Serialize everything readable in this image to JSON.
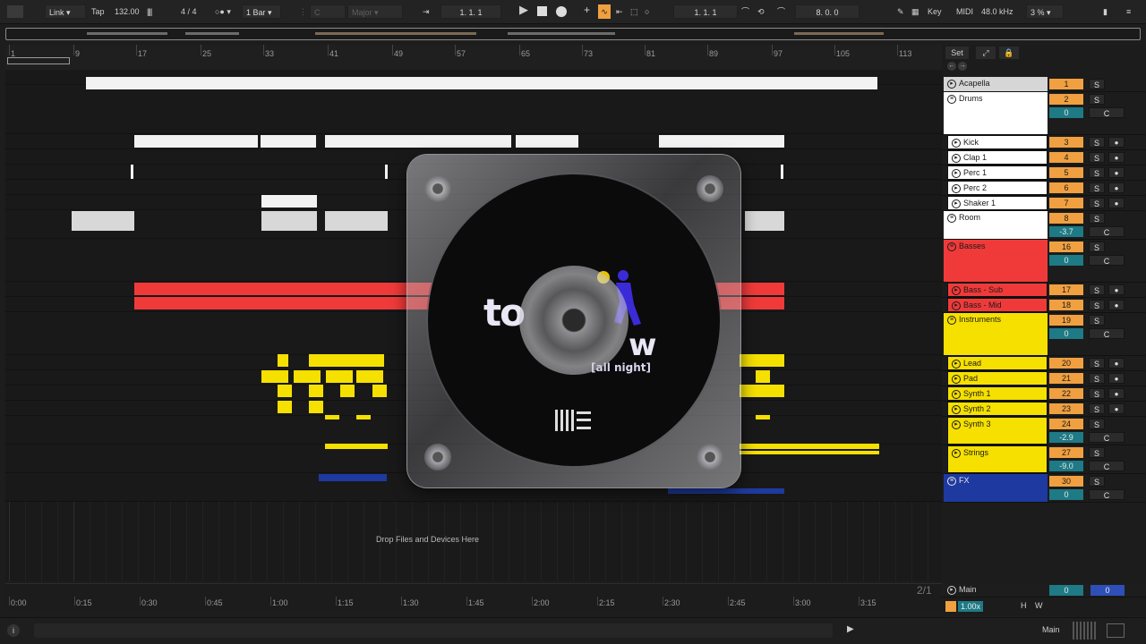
{
  "topbar": {
    "link": "Link",
    "tap": "Tap",
    "tempo": "132.00",
    "time_sig": "4 / 4",
    "quantize": "1 Bar",
    "key": "C",
    "scale": "Major",
    "position": "1.   1.   1",
    "loop_start": "1.   1.   1",
    "loop_length": "8.   0.   0",
    "key_label": "Key",
    "midi_label": "MIDI",
    "sample_rate": "48.0 kHz",
    "cpu": "3 %"
  },
  "ruler": {
    "bars": [
      "1",
      "9",
      "17",
      "25",
      "33",
      "41",
      "49",
      "57",
      "65",
      "73",
      "81",
      "89",
      "97",
      "105",
      "113"
    ]
  },
  "timeline": {
    "times": [
      "0:00",
      "0:15",
      "0:30",
      "0:45",
      "1:00",
      "1:15",
      "1:30",
      "1:45",
      "2:00",
      "2:15",
      "2:30",
      "2:45",
      "3:00",
      "3:15"
    ],
    "page": "2/1"
  },
  "drop_hint": "Drop Files and Devices Here",
  "disc": {
    "title_a": "to",
    "title_b": "w",
    "subtitle": "[all night]"
  },
  "headers": {
    "set_label": "Set",
    "tracks": [
      {
        "name": "Acapella",
        "num": "1",
        "s": "S",
        "type": "audio"
      },
      {
        "name": "Drums",
        "num": "2",
        "s": "S",
        "vol": "0",
        "c": "C",
        "type": "group"
      },
      {
        "name": "Kick",
        "num": "3",
        "s": "S",
        "type": "audio"
      },
      {
        "name": "Clap 1",
        "num": "4",
        "s": "S",
        "type": "audio"
      },
      {
        "name": "Perc 1",
        "num": "5",
        "s": "S",
        "type": "audio"
      },
      {
        "name": "Perc 2",
        "num": "6",
        "s": "S",
        "type": "audio"
      },
      {
        "name": "Shaker 1",
        "num": "7",
        "s": "S",
        "type": "audio"
      },
      {
        "name": "Room",
        "num": "8",
        "s": "S",
        "vol": "-3.7",
        "c": "C",
        "type": "group"
      },
      {
        "name": "Basses",
        "num": "16",
        "s": "S",
        "vol": "0",
        "c": "C",
        "type": "group"
      },
      {
        "name": "Bass - Sub",
        "num": "17",
        "s": "S",
        "type": "audio"
      },
      {
        "name": "Bass - Mid",
        "num": "18",
        "s": "S",
        "type": "audio"
      },
      {
        "name": "Instruments",
        "num": "19",
        "s": "S",
        "vol": "0",
        "c": "C",
        "type": "group"
      },
      {
        "name": "Lead",
        "num": "20",
        "s": "S",
        "type": "audio"
      },
      {
        "name": "Pad",
        "num": "21",
        "s": "S",
        "type": "audio"
      },
      {
        "name": "Synth 1",
        "num": "22",
        "s": "S",
        "type": "audio"
      },
      {
        "name": "Synth 2",
        "num": "23",
        "s": "S",
        "type": "audio"
      },
      {
        "name": "Synth 3",
        "num": "24",
        "s": "S",
        "vol": "-2.9",
        "c": "C",
        "type": "audio"
      },
      {
        "name": "Strings",
        "num": "27",
        "s": "S",
        "vol": "-9.0",
        "c": "C",
        "type": "audio"
      },
      {
        "name": "FX",
        "num": "30",
        "s": "S",
        "vol": "0",
        "c": "C",
        "type": "group"
      }
    ],
    "main": {
      "name": "Main",
      "vol_a": "0",
      "vol_b": "0"
    }
  },
  "status": {
    "speed": "1.00x",
    "h": "H",
    "w": "W",
    "main_label": "Main"
  },
  "colors": {
    "white_clip": "#f2f2f2",
    "red_clip": "#f03a3a",
    "yellow_clip": "#f5e000",
    "blue_clip": "#1e3aa0",
    "orange": "#f0a040",
    "teal": "#1e7a85"
  }
}
